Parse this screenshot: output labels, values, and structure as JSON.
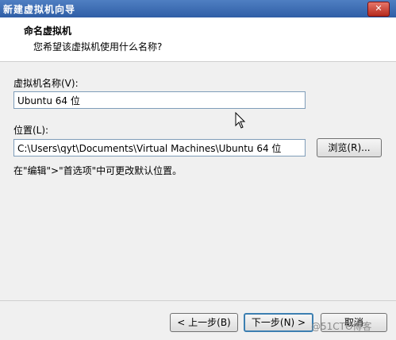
{
  "window": {
    "title": "新建虚拟机向导",
    "close_label": "✕"
  },
  "header": {
    "title": "命名虚拟机",
    "subtitle": "您希望该虚拟机使用什么名称?"
  },
  "name_field": {
    "label": "虚拟机名称(V):",
    "value": "Ubuntu 64 位"
  },
  "location_field": {
    "label": "位置(L):",
    "value": "C:\\Users\\qyt\\Documents\\Virtual Machines\\Ubuntu 64 位"
  },
  "browse_button": {
    "label": "浏览(R)..."
  },
  "note": "在\"编辑\">\"首选项\"中可更改默认位置。",
  "footer": {
    "back": "< 上一步(B)",
    "next": "下一步(N) >",
    "cancel": "取消"
  },
  "watermark": "@51CTO博客",
  "icons": {
    "cursor": "mouse-pointer-icon"
  }
}
